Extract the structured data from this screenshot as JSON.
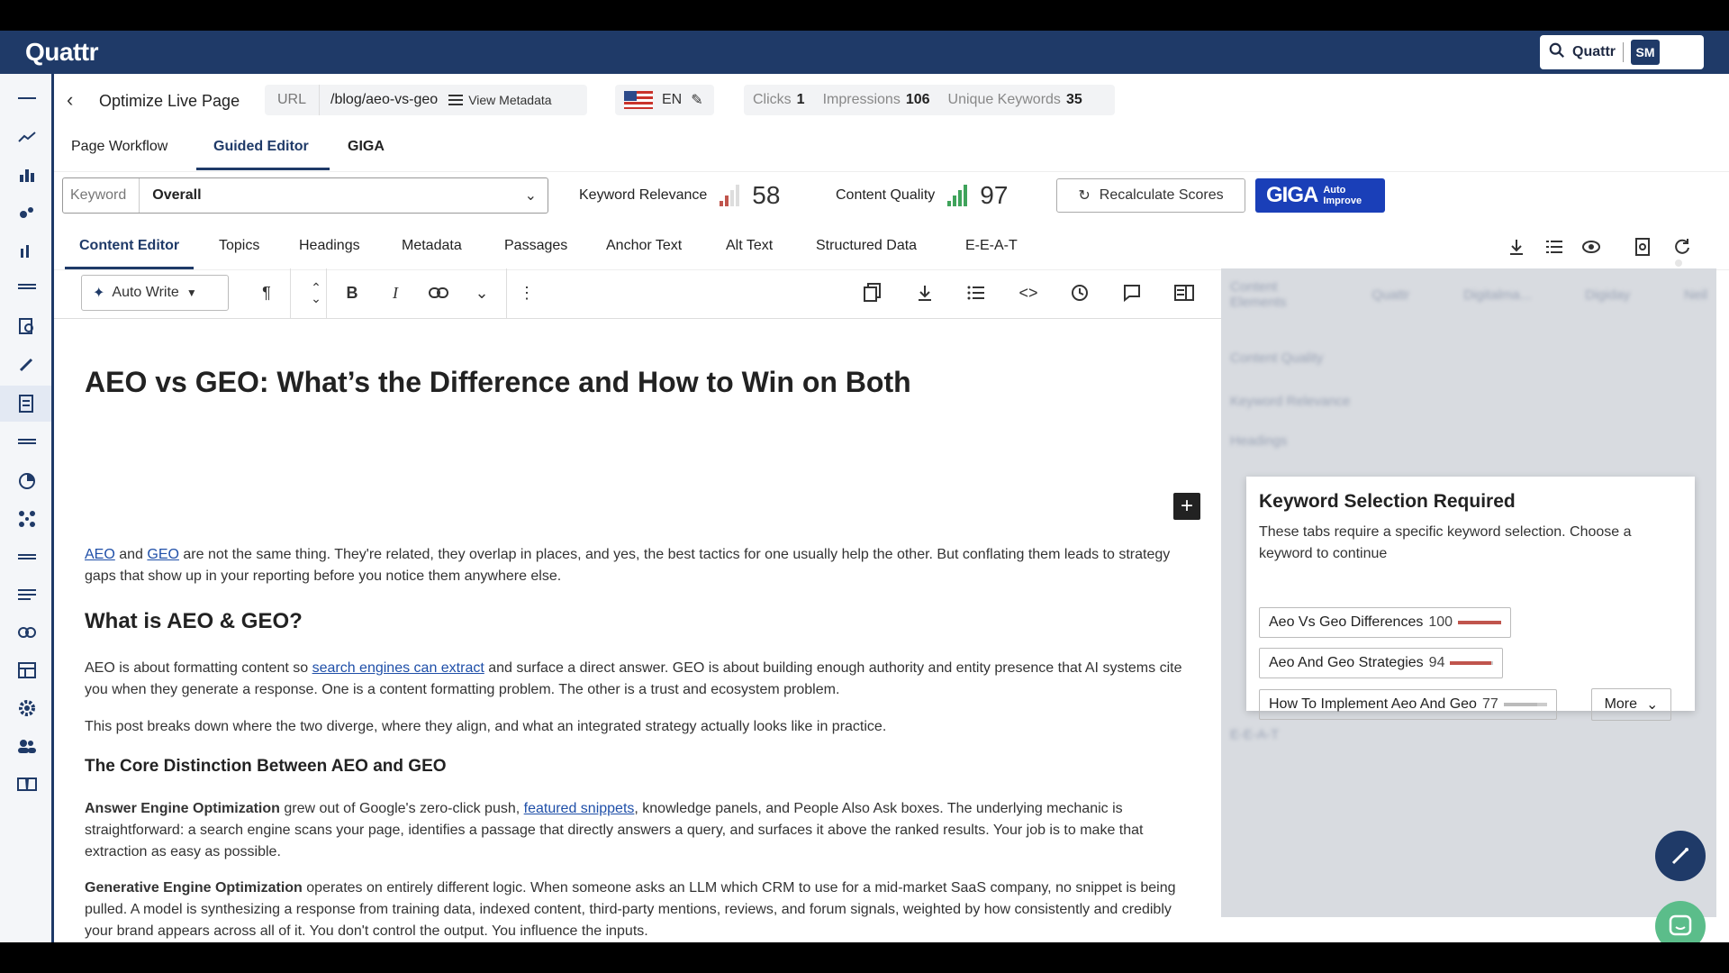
{
  "app": {
    "logo": "Quattr",
    "search_label": "Quattr",
    "avatar": "SM"
  },
  "header": {
    "title": "Optimize Live Page",
    "url_label": "URL",
    "url_value": "/blog/aeo-vs-geo",
    "view_metadata": "View Metadata",
    "language": "EN",
    "clicks_label": "Clicks",
    "clicks_value": "1",
    "impressions_label": "Impressions",
    "impressions_value": "106",
    "unique_keywords_label": "Unique Keywords",
    "unique_keywords_value": "35"
  },
  "primary_tabs": [
    "Page Workflow",
    "Guided Editor",
    "GIGA"
  ],
  "controls": {
    "keyword_label": "Keyword",
    "keyword_value": "Overall",
    "keyword_relevance_label": "Keyword Relevance",
    "keyword_relevance_value": "58",
    "content_quality_label": "Content Quality",
    "content_quality_value": "97",
    "recalculate_label": "Recalculate Scores",
    "giga_label": "GIGA",
    "auto_improve_line1": "Auto",
    "auto_improve_line2": "Improve"
  },
  "secondary_tabs": [
    "Content Editor",
    "Topics",
    "Headings",
    "Metadata",
    "Passages",
    "Anchor Text",
    "Alt Text",
    "Structured Data",
    "E-E-A-T"
  ],
  "toolbar": {
    "auto_write": "Auto Write"
  },
  "article": {
    "h1": "AEO vs GEO: What’s the Difference and How to Win on Both",
    "p1_link1": "AEO",
    "p1_and": " and ",
    "p1_link2": "GEO",
    "p1_rest": " are not the same thing. They're related, they overlap in places, and yes, the best tactics for one usually help the other. But conflating them leads to strategy gaps that show up in your reporting before you notice them anywhere else.",
    "h2": "What is AEO & GEO?",
    "p2_a": "AEO is about formatting content so ",
    "p2_link": "search engines can extract",
    "p2_b": " and surface a direct answer. GEO is about building enough authority and entity presence that AI systems cite you when they generate a response. One is a content formatting problem. The other is a trust and ecosystem problem.",
    "p3": "This post breaks down where the two diverge, where they align, and what an integrated strategy actually looks like in practice.",
    "h3": "The Core Distinction Between AEO and GEO",
    "p4_bold": "Answer Engine Optimization",
    "p4_a": " grew out of Google's zero-click push, ",
    "p4_link": "featured snippets",
    "p4_b": ", knowledge panels, and People Also Ask boxes. The underlying mechanic is straightforward: a search engine scans your page, identifies a passage that directly answers a query, and surfaces it above the ranked results. Your job is to make that extraction as easy as possible.",
    "p5_bold": "Generative Engine Optimization",
    "p5_rest": " operates on entirely different logic. When someone asks an LLM which CRM to use for a mid-market SaaS company, no snippet is being pulled. A model is synthesizing a response from training data, indexed content, third-party mentions, reviews, and forum signals, weighted by how consistently and credibly your brand appears across all of it. You don't control the output. You influence the inputs."
  },
  "keyword_card": {
    "title": "Keyword Selection Required",
    "desc": "These tabs require a specific keyword selection. Choose a keyword to continue",
    "chips": [
      {
        "label": "Aeo Vs Geo Differences",
        "score": "100",
        "fill": 1.0
      },
      {
        "label": "Aeo And Geo Strategies",
        "score": "94",
        "fill": 0.94
      },
      {
        "label": "How To Implement Aeo And Geo",
        "score": "77",
        "fill": 0.77
      }
    ],
    "more": "More"
  },
  "blurred_panel": {
    "rows": [
      "Content Elements",
      "Content Quality",
      "Keyword Relevance",
      "Headings",
      "E-E-A-T"
    ],
    "competitors": [
      "Quattr",
      "Digitalma...",
      "Digiday",
      "Neil"
    ]
  },
  "colors": {
    "brand": "#1f3a68",
    "giga": "#1a3fb8",
    "link": "#1f4fa8",
    "chip_bar": "#c0554d"
  }
}
